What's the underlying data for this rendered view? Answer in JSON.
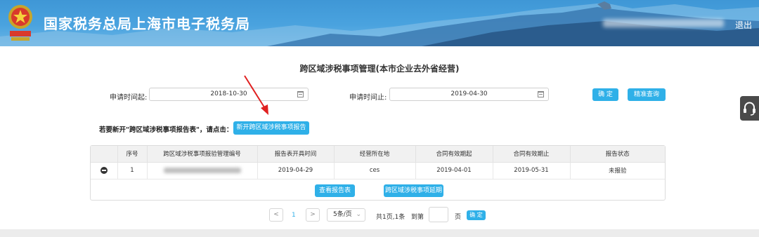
{
  "header": {
    "title": "国家税务总局上海市电子税务局",
    "logout": "退出"
  },
  "page": {
    "title": "跨区域涉税事项管理(本市企业去外省经营)"
  },
  "search": {
    "start_label": "申请时间起",
    "start_value": "2018-10-30",
    "end_label": "申请时间止",
    "end_value": "2019-04-30",
    "confirm_label": "确 定",
    "precise_label": "精准查询"
  },
  "notice": {
    "text": "若要新开\"跨区域涉税事项报告表\"，请点击：",
    "button_label": "新开跨区域涉税事项报告"
  },
  "table": {
    "headers": [
      "",
      "序号",
      "跨区域涉税事项报验管理编号",
      "报告表开具时间",
      "经营所在地",
      "合同有效期起",
      "合同有效期止",
      "报告状态"
    ],
    "rows": [
      {
        "index": "1",
        "issue_time": "2019-04-29",
        "location": "ces",
        "contract_start": "2019-04-01",
        "contract_end": "2019-05-31",
        "status": "未报验"
      }
    ],
    "view_button": "查看报告表",
    "extend_button": "跨区域涉税事项延期"
  },
  "pagination": {
    "prev": "<",
    "current_page": "1",
    "next": ">",
    "page_size": "5条/页",
    "summary": "共1页,1条",
    "goto_label": "到第",
    "goto_value": "",
    "page_unit": "页",
    "confirm_label": "确 定"
  },
  "colors": {
    "header": "#4aa3df",
    "accent_button": "#2fb0e8",
    "arrow": "#e02020"
  },
  "icons": [
    "emblem-icon",
    "calendar-icon",
    "minus-circle-icon",
    "chevron-down-icon",
    "headset-icon",
    "arrow-icon"
  ]
}
